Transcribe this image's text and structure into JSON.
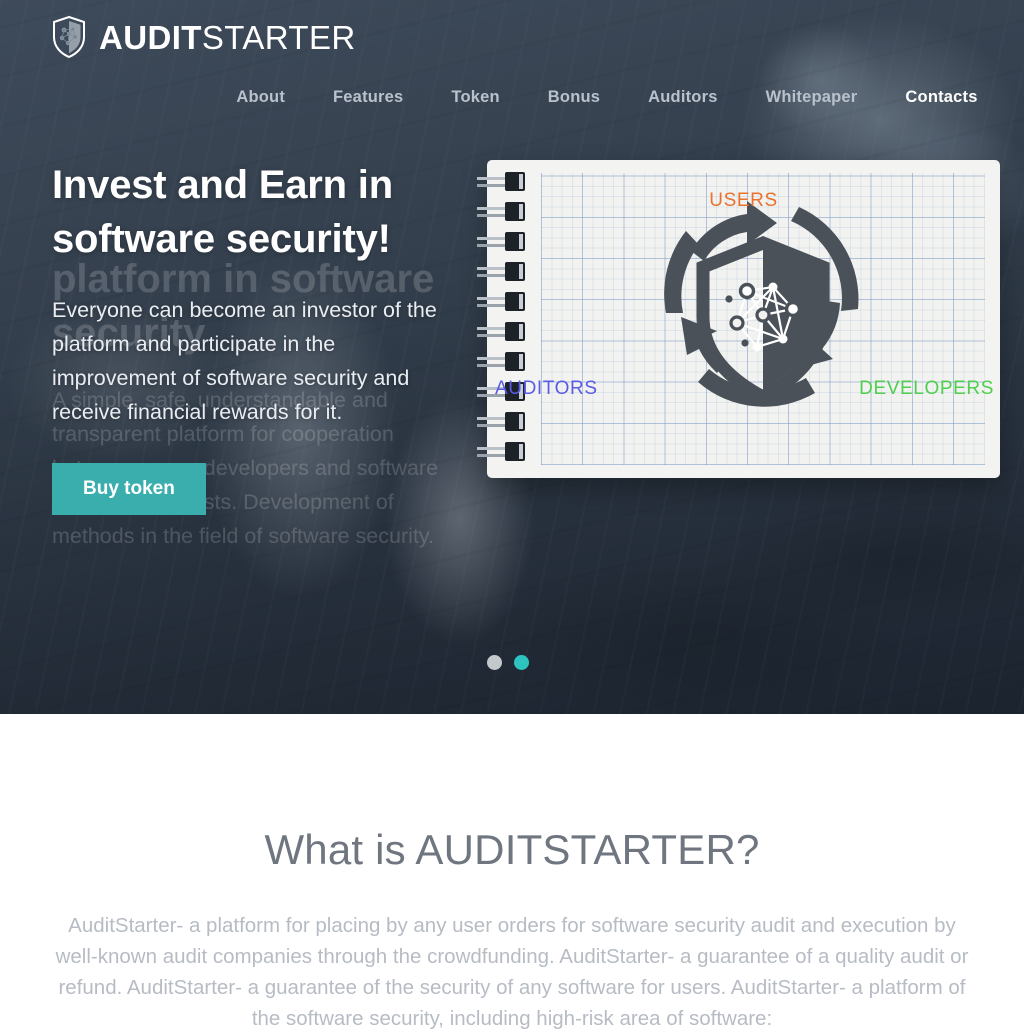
{
  "brand": {
    "name_bold": "AUDIT",
    "name_light": "STARTER",
    "logo_icon": "shield-network-icon"
  },
  "nav": {
    "items": [
      {
        "label": "About",
        "active": false
      },
      {
        "label": "Features",
        "active": false
      },
      {
        "label": "Token",
        "active": false
      },
      {
        "label": "Bonus",
        "active": false
      },
      {
        "label": "Auditors",
        "active": false
      },
      {
        "label": "Whitepaper",
        "active": false
      },
      {
        "label": "Contacts",
        "active": true
      }
    ]
  },
  "hero": {
    "title": "Invest and Earn in software security!",
    "description": "Everyone can become an investor of the platform and participate in the improvement of software security and receive financial rewards for it.",
    "cta_label": "Buy token",
    "cta_color": "#3aadad",
    "previous_slide": {
      "title": "platform in software security",
      "description": "A simple, safe, understandable and transparent platform for cooperation between users, developers and software security specialists. Development of methods in the field of software security."
    },
    "carousel": {
      "dots": [
        {
          "active": false,
          "color": "#c3c8cc"
        },
        {
          "active": true,
          "color": "#2dc4bf"
        }
      ]
    },
    "illustration": {
      "type": "spiral-notepad-diagram",
      "shield_color": "#4a5159",
      "labels": [
        {
          "name": "users",
          "text": "USERS",
          "color": "#e8722e"
        },
        {
          "name": "auditors",
          "text": "AUDITORS",
          "color": "#5a5ae8"
        },
        {
          "name": "developers",
          "text": "DEVELOPERS",
          "color": "#4ed04e"
        }
      ]
    }
  },
  "about": {
    "heading": "What is AUDITSTARTER?",
    "paragraph": "AuditStarter- a platform for placing by any user orders for software security audit and execution by well-known audit companies through the crowdfunding. AuditStarter- a guarantee of a quality audit or refund. AuditStarter- a guarantee of the security of any software for users. AuditStarter- a platform of the software security, including high-risk area of software:"
  }
}
